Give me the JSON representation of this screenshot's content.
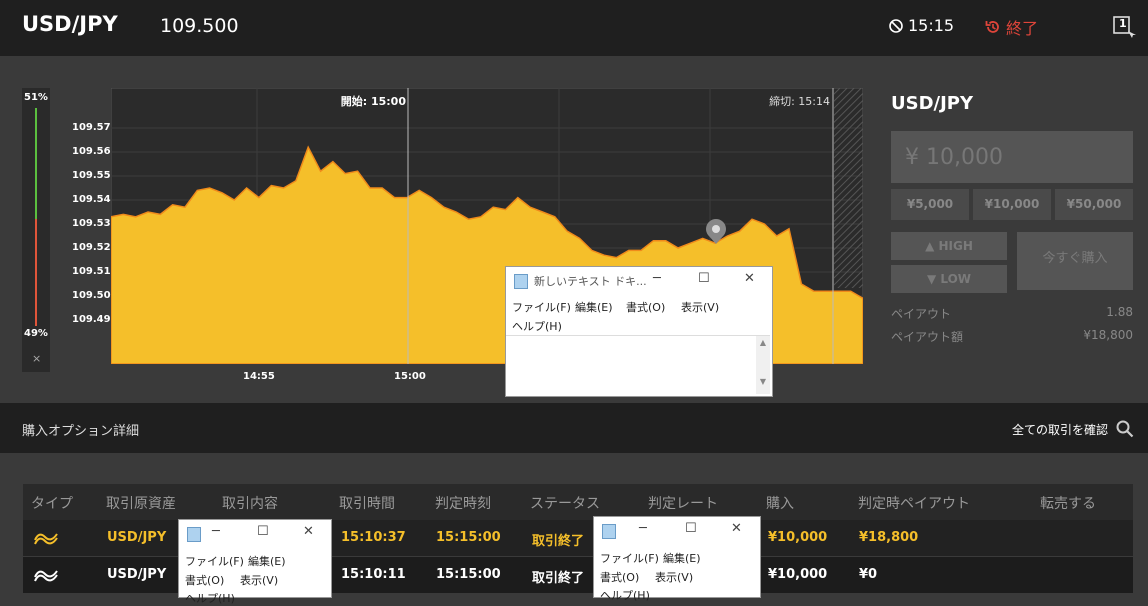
{
  "header": {
    "pair": "USD/JPY",
    "price": "109.500",
    "time": "15:15",
    "end_label": "終了",
    "window_count": "1"
  },
  "gauge": {
    "top_pct": "51%",
    "bottom_pct": "49%",
    "close": "×"
  },
  "chart_data": {
    "type": "area",
    "y_ticks": [
      "109.57",
      "109.56",
      "109.55",
      "109.54",
      "109.53",
      "109.52",
      "109.51",
      "109.50",
      "109.49"
    ],
    "x_ticks": [
      "14:55",
      "15:00"
    ],
    "start_label": "開始: 15:00",
    "close_label": "締切: 15:14",
    "ylim": [
      109.48,
      109.58
    ],
    "y": [
      109.533,
      109.534,
      109.533,
      109.535,
      109.534,
      109.538,
      109.537,
      109.544,
      109.545,
      109.543,
      109.54,
      109.545,
      109.541,
      109.546,
      109.545,
      109.548,
      109.562,
      109.552,
      109.556,
      109.551,
      109.552,
      109.545,
      109.545,
      109.541,
      109.541,
      109.544,
      109.541,
      109.537,
      109.535,
      109.532,
      109.533,
      109.537,
      109.536,
      109.541,
      109.537,
      109.535,
      109.533,
      109.527,
      109.524,
      109.519,
      109.517,
      109.516,
      109.519,
      109.519,
      109.523,
      109.523,
      109.52,
      109.522,
      109.524,
      109.522,
      109.525,
      109.527,
      109.532,
      109.53,
      109.525,
      109.528,
      109.505,
      109.502,
      109.502,
      109.502,
      109.502,
      109.499
    ],
    "grid": true,
    "series_color": "#f5bf2a"
  },
  "panel": {
    "title": "USD/JPY",
    "amount": "¥ 10,000",
    "chips": [
      "¥5,000",
      "¥10,000",
      "¥50,000"
    ],
    "high": "HIGH",
    "low": "LOW",
    "buy_now": "今すぐ購入",
    "payout_label": "ペイアウト",
    "payout_value": "1.88",
    "payout_amount_label": "ペイアウト額",
    "payout_amount_value": "¥18,800"
  },
  "details": {
    "title": "購入オプション詳細",
    "view_all": "全ての取引を確認"
  },
  "table": {
    "headers": [
      "タイプ",
      "取引原資産",
      "取引内容",
      "取引時間",
      "判定時刻",
      "ステータス",
      "判定レート",
      "購入",
      "判定時ペイアウト",
      "転売する"
    ],
    "rows": [
      {
        "asset": "USD/JPY",
        "time": "15:10:37",
        "judge_time": "15:15:00",
        "status": "取引終了",
        "buy": "¥10,000",
        "payout": "¥18,800",
        "color": "#f5bf2a"
      },
      {
        "asset": "USD/JPY",
        "time": "15:10:11",
        "judge_time": "15:15:00",
        "status": "取引終了",
        "buy": "¥10,000",
        "payout": "¥0",
        "color": "#ffffff"
      }
    ]
  },
  "notepad_main": {
    "title": "新しいテキスト ドキ...",
    "menu": [
      "ファイル(F)",
      "編集(E)",
      "書式(O)",
      "表示(V)",
      "ヘルプ(H)"
    ]
  },
  "notepad_small1": {
    "menu": [
      "ファイル(F)",
      "編集(E)",
      "書式(O)",
      "表示(V)",
      "ヘルプ(H)"
    ]
  },
  "notepad_small2": {
    "menu": [
      "ファイル(F)",
      "編集(E)",
      "書式(O)",
      "表示(V)",
      "ヘルプ(H)"
    ]
  }
}
